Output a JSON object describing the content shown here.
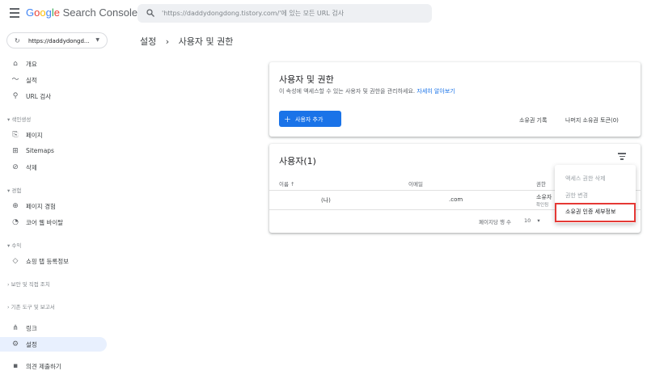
{
  "header": {
    "logo_google": [
      "G",
      "o",
      "o",
      "g",
      "l",
      "e"
    ],
    "logo_product": "Search Console",
    "search_placeholder": "'https://daddydongdong.tistory.com/'에 있는 모든 URL 검사"
  },
  "sidebar": {
    "property": "https://daddydongd...",
    "items": [
      {
        "label": "개요",
        "icon": "home-icon"
      },
      {
        "label": "실적",
        "icon": "trending-icon"
      },
      {
        "label": "URL 검사",
        "icon": "search-icon"
      },
      {
        "label": "페이지",
        "icon": "pages-icon"
      },
      {
        "label": "Sitemaps",
        "icon": "sitemap-icon"
      },
      {
        "label": "삭제",
        "icon": "visibility-off-icon"
      },
      {
        "label": "페이지 경험",
        "icon": "plus-circle-icon"
      },
      {
        "label": "코어 웹 바이탈",
        "icon": "speed-icon"
      },
      {
        "label": "쇼핑 탭 등록정보",
        "icon": "tag-icon"
      },
      {
        "label": "링크",
        "icon": "links-icon"
      },
      {
        "label": "설정",
        "icon": "gear-icon"
      },
      {
        "label": "의견 제출하기",
        "icon": "feedback-icon"
      }
    ],
    "sections": {
      "indexing": "색인생성",
      "experience": "경험",
      "enhancements": "수익",
      "security": "보안 및 직접 조치",
      "legacy": "기존 도구 및 보고서"
    }
  },
  "breadcrumb": {
    "parent": "설정",
    "separator": "›",
    "current": "사용자 및 권한"
  },
  "permissions_card": {
    "title": "사용자 및 권한",
    "subtitle": "이 속성에 액세스할 수 있는 사용자 및 권한을 관리하세요.",
    "learn_more": "자세히 알아보기",
    "add_user": "사용자 추가",
    "ownership_history": "소유권 기록",
    "remaining_owners": "나머지 소유권 토큰(0)"
  },
  "users_card": {
    "title": "사용자(1)",
    "columns": {
      "name": "이름",
      "email": "이메일",
      "permission": "권한"
    },
    "sort_indicator": "↑",
    "rows": [
      {
        "name": "(나)",
        "email": ".com",
        "permission": "소유자",
        "permission_sub": "확인됨"
      }
    ],
    "rows_per_page_label": "페이지당 행 수",
    "rows_per_page": "10"
  },
  "menu": {
    "items": [
      {
        "label": "액세스 권한 삭제",
        "disabled": true
      },
      {
        "label": "권한 변경",
        "disabled": true
      },
      {
        "label": "소유권 인증 세부정보",
        "disabled": false
      }
    ]
  },
  "colors": {
    "accent": "#1a73e8",
    "highlight_border": "#e53935",
    "active_nav": "#e8f0fe"
  }
}
